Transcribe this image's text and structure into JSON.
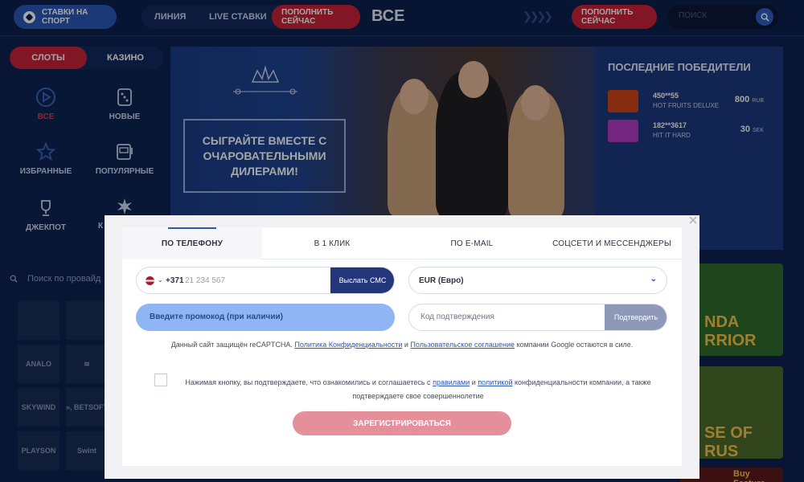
{
  "header": {
    "sport_label": "СТАВКИ НА СПОРТ",
    "nav_line": "ЛИНИЯ",
    "nav_live": "LIVE СТАВКИ",
    "deposit_label": "ПОПОЛНИТЬ СЕЙЧАС",
    "all_label": "ВСЕ",
    "deposit_label_2": "ПОПОЛНИТЬ СЕЙЧАС",
    "search_placeholder": "ПОИСК"
  },
  "categories": {
    "slots": "СЛОТЫ",
    "casino": "КАЗИНО"
  },
  "left_menu": [
    {
      "label": "ВСЕ",
      "icon": "play-icon",
      "active": true
    },
    {
      "label": "НОВЫЕ",
      "icon": "dice-icon"
    },
    {
      "label": "ИЗБРАННЫЕ",
      "icon": "star-icon"
    },
    {
      "label": "ПОПУЛЯРНЫЕ",
      "icon": "slot-machine-icon"
    },
    {
      "label": "ДЖЕКПОТ",
      "icon": "trophy-icon"
    },
    {
      "label": "К",
      "icon": "drops-logo-icon"
    }
  ],
  "provider_search": {
    "placeholder": "Поиск по провайд"
  },
  "providers": [
    "ANALO",
    "≋",
    "SKYWIND",
    "», BETSOFT",
    "PLAYSON",
    "Swint"
  ],
  "banner": {
    "text": "СЫГРАЙТЕ ВМЕСТЕ С ОЧАРОВАТЕЛЬНЫМИ ДИЛЕРАМИ!"
  },
  "winners": {
    "title": "ПОСЛЕДНИЕ ПОБЕДИТЕЛИ",
    "items": [
      {
        "name": "450**55",
        "game": "HOT FRUITS DELUXE",
        "amount": "800",
        "currency": "RUB",
        "color": "#d14418"
      },
      {
        "name": "182**3617",
        "game": "HIT IT HARD",
        "amount": "30",
        "currency": "SEK",
        "color": "#b23ac2"
      }
    ]
  },
  "tiles": [
    {
      "text": "NDA RRIOR",
      "color": "#2f6a2a"
    },
    {
      "text": "SE OF RUS",
      "color": "#4c6b2b"
    },
    {
      "text": "Buy Feature",
      "color": "#5a1a1a"
    }
  ],
  "modal": {
    "tabs": [
      "ПО ТЕЛЕФОНУ",
      "В 1 КЛИК",
      "ПО E-MAIL",
      "СОЦСЕТИ И МЕССЕНДЖЕРЫ"
    ],
    "phone_prefix": "+371",
    "phone_placeholder": "21 234 567",
    "sms_button": "Выслать СМС",
    "currency": "EUR (Евро)",
    "promo_placeholder": "Введите промокод (при наличии)",
    "code_placeholder": "Код подтверждения",
    "confirm_button": "Подтвердить",
    "captcha_pre": "Данный сайт защищён reCAPTCHA.",
    "captcha_privacy": "Политика Конфиденциальности",
    "captcha_and": "и",
    "captcha_terms": "Пользовательское соглашение",
    "captcha_post": "компании Google остаются в силе.",
    "agree_pre": "Нажимая кнопку, вы подтверждаете, что ознакомились и соглашаетесь с",
    "agree_rules": "правилами",
    "agree_and": "и",
    "agree_policy": "политикой",
    "agree_post": "конфиденциальности компании, а также подтверждаете свое совершеннолетие",
    "register_button": "ЗАРЕГИСТРИРОВАТЬСЯ"
  },
  "colors": {
    "accent_red": "#c8233a",
    "accent_blue": "#2a58b5",
    "bg": "#0d2150"
  }
}
